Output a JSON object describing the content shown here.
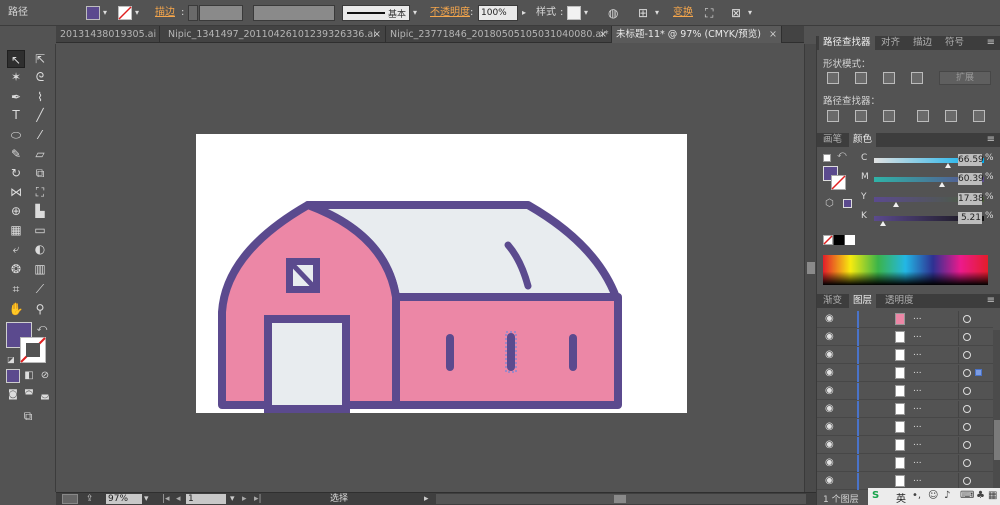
{
  "control_bar": {
    "object_type": "路径",
    "fill_color": "#5b4a8e",
    "stroke_label": "描边",
    "stroke_style": "基本",
    "opacity_label": "不透明度",
    "opacity_value": "100%",
    "style_label": "样式",
    "transform_label": "变换"
  },
  "tabs": [
    {
      "label": "20131438019305.ai",
      "close": "×"
    },
    {
      "label": "Nipic_1341497_20110426101239326336.ai",
      "close": "×"
    },
    {
      "label": "Nipic_23771846_20180505105031040080.ai*",
      "close": "×"
    },
    {
      "label": "未标题-11* @ 97% (CMYK/预览)",
      "close": "×"
    }
  ],
  "artwork": {
    "outline_color": "#5b4a8e",
    "wall_color": "#ec87a6",
    "roof_color": "#e8ecef",
    "door_color": "#e8ecef"
  },
  "status": {
    "zoom": "97%",
    "page": "1",
    "tool": "选择"
  },
  "pathfinder": {
    "tabs": [
      "路径查找器",
      "对齐",
      "描边",
      "符号"
    ],
    "shape_modes_label": "形状模式：",
    "pathfinders_label": "路径查找器：",
    "expand_label": "扩展"
  },
  "color_panel": {
    "tabs": [
      "画笔",
      "颜色"
    ],
    "channels": [
      {
        "name": "C",
        "value": "66.59",
        "unit": "%",
        "level": 0.666,
        "gradient": "#e1e1e1,#00aeef"
      },
      {
        "name": "M",
        "value": "60.39",
        "unit": "%",
        "level": 0.604,
        "gradient": "#2fb3a7,#5b4a8e"
      },
      {
        "name": "Y",
        "value": "17.38",
        "unit": "%",
        "level": 0.174,
        "gradient": "#5b4a8e,#4b5e3a"
      },
      {
        "name": "K",
        "value": "5.21",
        "unit": "%",
        "level": 0.052,
        "gradient": "#5b4a8e,#111111"
      }
    ]
  },
  "layers_panel": {
    "tabs": [
      "渐变",
      "图层",
      "透明度"
    ],
    "rows": [
      {
        "eye": "◉",
        "name": "...",
        "thumb_color": "#ec87a6"
      },
      {
        "eye": "◉",
        "name": "...",
        "thumb_color": "#ffffff"
      },
      {
        "eye": "◉",
        "name": "...",
        "thumb_color": "#ffffff"
      },
      {
        "eye": "◉",
        "name": "...",
        "thumb_color": "#ffffff"
      },
      {
        "eye": "◉",
        "name": "...",
        "thumb_color": "#ffffff"
      },
      {
        "eye": "◉",
        "name": "...",
        "thumb_color": "#ffffff"
      },
      {
        "eye": "◉",
        "name": "...",
        "thumb_color": "#ffffff"
      },
      {
        "eye": "◉",
        "name": "...",
        "thumb_color": "#ffffff"
      },
      {
        "eye": "◉",
        "name": "...",
        "thumb_color": "#ffffff"
      },
      {
        "eye": "◉",
        "name": "...",
        "thumb_color": "#ffffff"
      }
    ],
    "footer": "1 个图层"
  },
  "taskbar": {
    "ime": "英"
  }
}
